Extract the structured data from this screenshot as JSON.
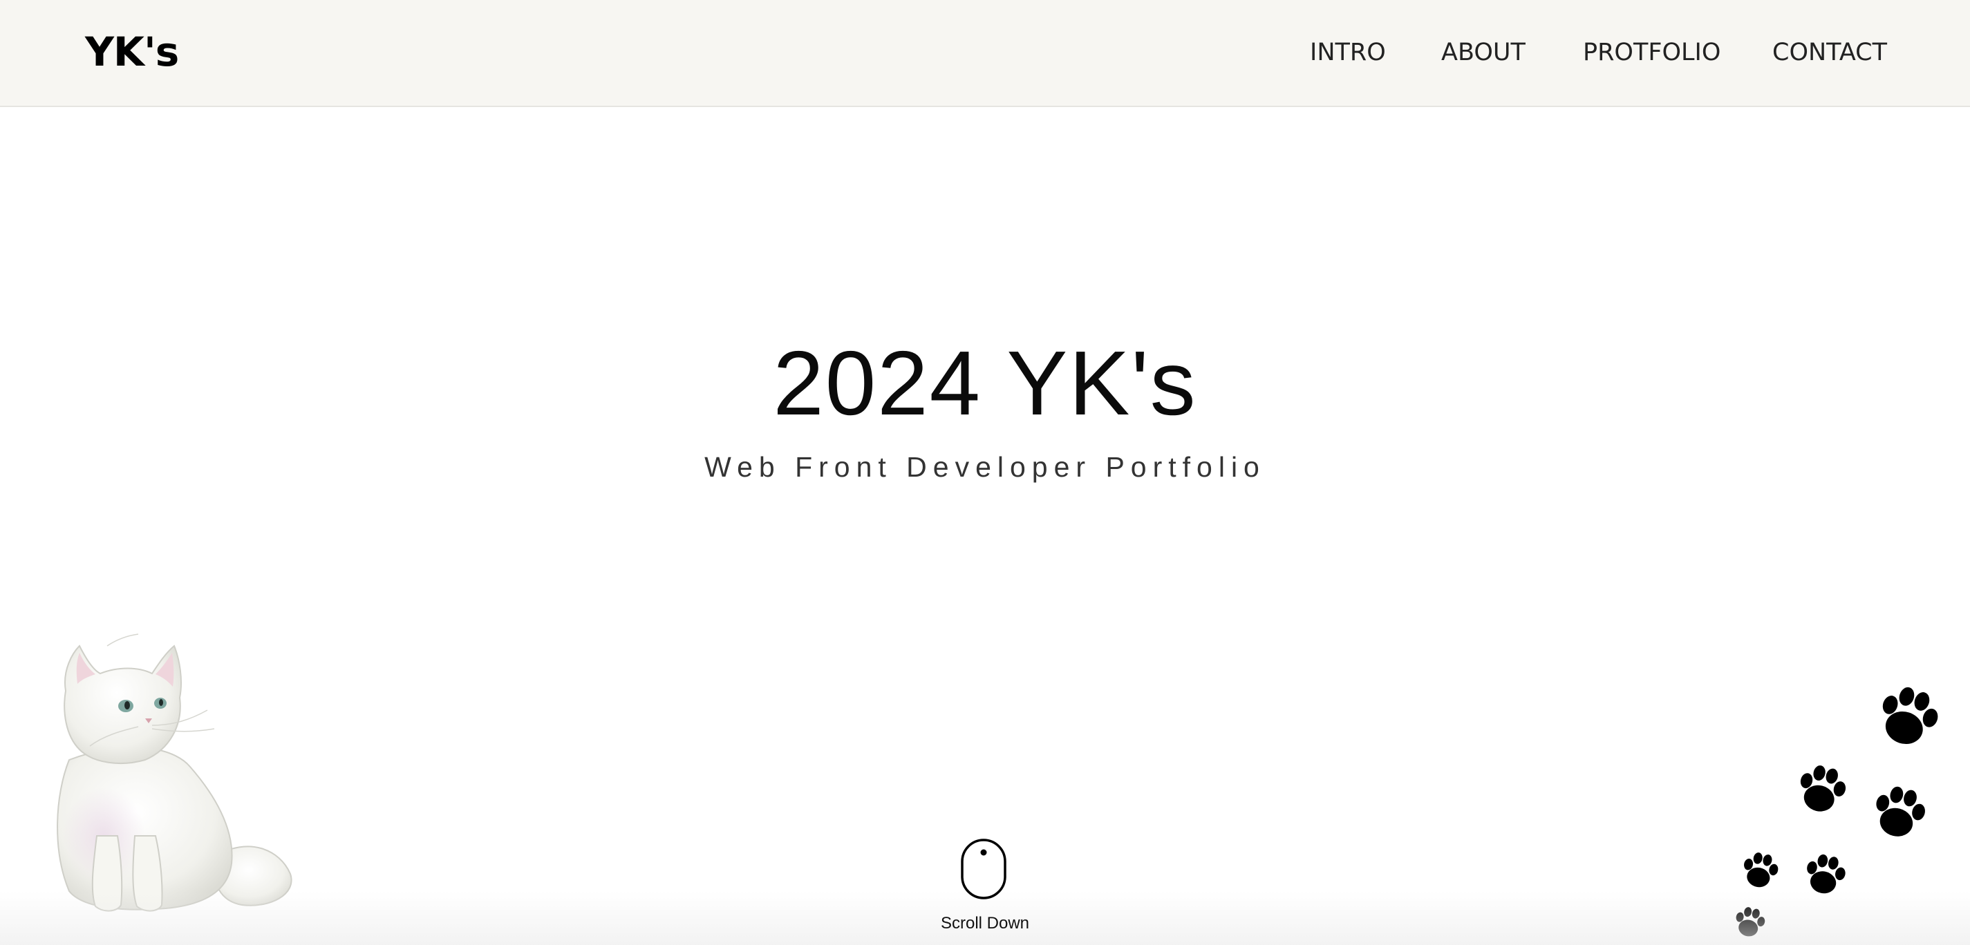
{
  "header": {
    "logo": "YK's",
    "nav": [
      {
        "label": "INTRO"
      },
      {
        "label": "ABOUT"
      },
      {
        "label": "PROTFOLIO"
      },
      {
        "label": "CONTACT"
      }
    ]
  },
  "hero": {
    "title": "2024 YK's",
    "subtitle": "Web Front Developer Portfolio"
  },
  "scroll": {
    "label": "Scroll Down",
    "icon": "mouse-icon"
  },
  "decor": {
    "cat": "cat-illustration",
    "paws": "paw-print-icon"
  },
  "colors": {
    "header_bg": "#f7f6f2",
    "text": "#111111",
    "page_bg": "#ffffff"
  }
}
